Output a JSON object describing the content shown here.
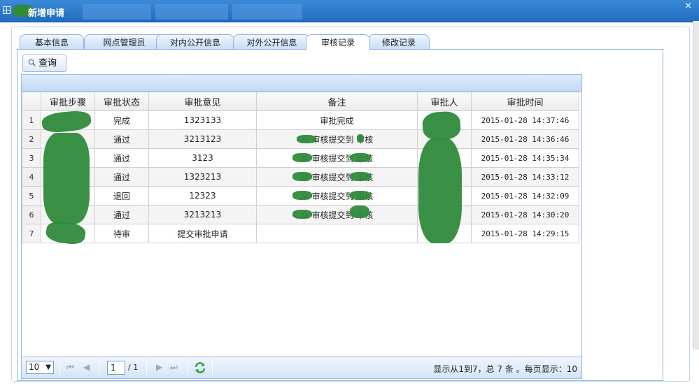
{
  "window": {
    "title": "新增申请",
    "close_glyph": "×"
  },
  "tabs": [
    {
      "label": "基本信息",
      "active": false
    },
    {
      "label": "网点管理员",
      "active": false
    },
    {
      "label": "对内公开信息",
      "active": false
    },
    {
      "label": "对外公开信息",
      "active": false
    },
    {
      "label": "审核记录",
      "active": true
    },
    {
      "label": "修改记录",
      "active": false
    }
  ],
  "toolbar": {
    "query_label": "查询",
    "query_icon": "magnifier-icon"
  },
  "table": {
    "columns": [
      "审批步骤",
      "审批状态",
      "审批意见",
      "备注",
      "审批人",
      "审批时间"
    ],
    "rows": [
      {
        "num": "1",
        "step": "",
        "status": "完成",
        "opinion": "1323133",
        "remark": "审批完成",
        "approver": "",
        "time": "2015-01-28 14:37:46"
      },
      {
        "num": "2",
        "step": "",
        "status": "通过",
        "opinion": "3213123",
        "remark": "从 审核提交到 审核",
        "approver": "",
        "time": "2015-01-28 14:36:46"
      },
      {
        "num": "3",
        "step": "",
        "status": "通过",
        "opinion": "3123",
        "remark": "从 审核提交到 审核",
        "approver": "",
        "time": "2015-01-28 14:35:34"
      },
      {
        "num": "4",
        "step": "",
        "status": "通过",
        "opinion": "1323213",
        "remark": "从 审核提交到 审核",
        "approver": "",
        "time": "2015-01-28 14:33:12"
      },
      {
        "num": "5",
        "step": "",
        "status": "退回",
        "opinion": "12323",
        "remark": "从 审核提交到 审核",
        "approver": "",
        "time": "2015-01-28 14:32:09"
      },
      {
        "num": "6",
        "step": "",
        "status": "通过",
        "opinion": "3213213",
        "remark": "从 审核提交到 审核",
        "approver": "",
        "time": "2015-01-28 14:30:20"
      },
      {
        "num": "7",
        "step": "",
        "status": "待审",
        "opinion": "提交审批申请",
        "remark": "",
        "approver": "",
        "time": "2015-01-28 14:29:15"
      }
    ]
  },
  "pager": {
    "page_size": "10",
    "page_size_arrow": "▼",
    "current_page": "1",
    "total_pages": "/ 1",
    "info": "显示从1到7，总 7 条 。每页显示：10",
    "first_glyph": "⏮",
    "prev_glyph": "◀",
    "next_glyph": "▶",
    "last_glyph": "⏭"
  },
  "colors": {
    "title_bar": "#1f6cc0",
    "tab_border": "#8db2e3",
    "grid_border": "#99bbe8",
    "redaction": "#2f8a3a"
  }
}
